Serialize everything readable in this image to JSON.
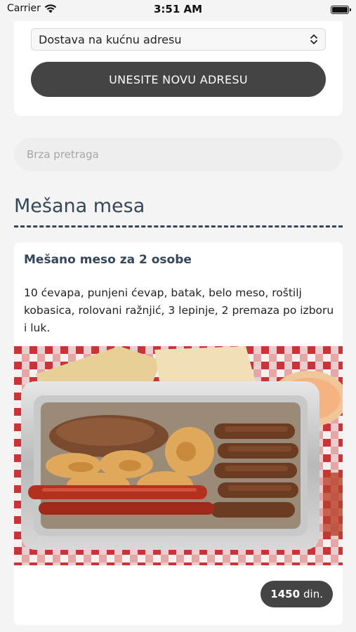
{
  "status_bar": {
    "carrier": "Carrier",
    "time": "3:51 AM"
  },
  "delivery": {
    "selected_option": "Dostava na kućnu adresu",
    "new_address_button": "UNESITE NOVU ADRESU"
  },
  "search": {
    "placeholder": "Brza pretraga",
    "value": ""
  },
  "section": {
    "title": "Mešana mesa"
  },
  "product": {
    "name": "Mešano meso za 2 osobe",
    "description": "10 ćevapa, punjeni ćevap, batak, belo meso, roštilj kobasica, rolovani ražnjić, 3 lepinje, 2 premaza po izboru i luk.",
    "price_amount": "1450",
    "price_currency": "din."
  },
  "colors": {
    "accent": "#34475a",
    "button": "#444444",
    "background": "#f4f4f4"
  }
}
